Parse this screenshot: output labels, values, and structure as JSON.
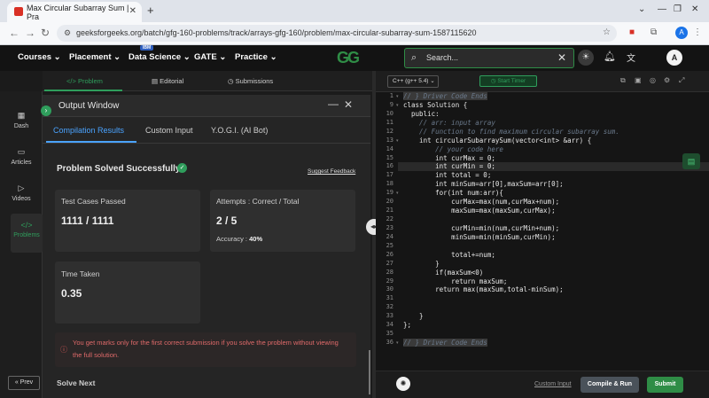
{
  "browser": {
    "tab_title": "Max Circular Subarray Sum | Pra",
    "url": "geeksforgeeks.org/batch/gfg-160-problems/track/arrays-gfg-160/problem/max-circular-subarray-sum-1587115620",
    "profile_initial": "A"
  },
  "nav": {
    "items": [
      "Courses",
      "Placement",
      "Data Science",
      "GATE",
      "Practice"
    ],
    "ibm_badge": "IBM",
    "logo": "GG",
    "search_placeholder": "Search...",
    "user_initial": "A"
  },
  "problem_tabs": [
    "Problem",
    "Editorial",
    "Submissions"
  ],
  "sidebar": {
    "items": [
      "Dash",
      "Articles",
      "Videos",
      "Problems"
    ],
    "prev": "Prev"
  },
  "output": {
    "title": "Output Window",
    "tabs": [
      "Compilation Results",
      "Custom Input",
      "Y.O.G.I. (AI Bot)"
    ],
    "status": "Problem Solved Successfully",
    "feedback": "Suggest Feedback",
    "test_cases_label": "Test Cases Passed",
    "test_cases_value": "1111 / 1111",
    "attempts_label": "Attempts : Correct / Total",
    "attempts_value": "2 / 5",
    "accuracy_label": "Accuracy :",
    "accuracy_value": "40%",
    "time_label": "Time Taken",
    "time_value": "0.35",
    "warning": "You get marks only for the first correct submission if you solve the problem without viewing the full solution.",
    "solve_next": "Solve Next"
  },
  "editor": {
    "language": "C++ (g++ 5.4)",
    "timer": "Start Timer",
    "lines": [
      {
        "n": "1",
        "t": "// } Driver Code Ends",
        "cls": "cm",
        "fold": true
      },
      {
        "n": "9",
        "t": "class Solution {",
        "fold": true
      },
      {
        "n": "10",
        "t": "  public:"
      },
      {
        "n": "11",
        "t": "    // arr: input array",
        "cls": "cm"
      },
      {
        "n": "12",
        "t": "    // Function to find maximum circular subarray sum.",
        "cls": "cm"
      },
      {
        "n": "13",
        "t": "    int circularSubarraySum(vector<int> &arr) {",
        "fold": true
      },
      {
        "n": "14",
        "t": "        // your code here",
        "cls": "cm"
      },
      {
        "n": "15",
        "t": "        int curMax = 0;"
      },
      {
        "n": "16",
        "t": "        int curMin = 0;",
        "hl": true
      },
      {
        "n": "17",
        "t": "        int total = 0;"
      },
      {
        "n": "18",
        "t": "        int minSum=arr[0],maxSum=arr[0];"
      },
      {
        "n": "19",
        "t": "        for(int num:arr){",
        "fold": true
      },
      {
        "n": "20",
        "t": "            curMax=max(num,curMax+num);"
      },
      {
        "n": "21",
        "t": "            maxSum=max(maxSum,curMax);"
      },
      {
        "n": "22",
        "t": ""
      },
      {
        "n": "23",
        "t": "            curMin=min(num,curMin+num);"
      },
      {
        "n": "24",
        "t": "            minSum=min(minSum,curMin);"
      },
      {
        "n": "25",
        "t": ""
      },
      {
        "n": "26",
        "t": "            total+=num;"
      },
      {
        "n": "27",
        "t": "        }"
      },
      {
        "n": "28",
        "t": "        if(maxSum<0)"
      },
      {
        "n": "29",
        "t": "            return maxSum;"
      },
      {
        "n": "30",
        "t": "        return max(maxSum,total-minSum);"
      },
      {
        "n": "31",
        "t": ""
      },
      {
        "n": "32",
        "t": ""
      },
      {
        "n": "33",
        "t": "    }"
      },
      {
        "n": "34",
        "t": "};"
      },
      {
        "n": "35",
        "t": ""
      },
      {
        "n": "36",
        "t": "// } Driver Code Ends",
        "cls": "cm",
        "fold": true
      }
    ],
    "custom_input": "Custom Input",
    "compile_run": "Compile & Run",
    "submit": "Submit"
  },
  "colors": {
    "accent_green": "#2f8d46",
    "accent_blue": "#4aa3ff",
    "warning_red": "#e06a6a"
  }
}
